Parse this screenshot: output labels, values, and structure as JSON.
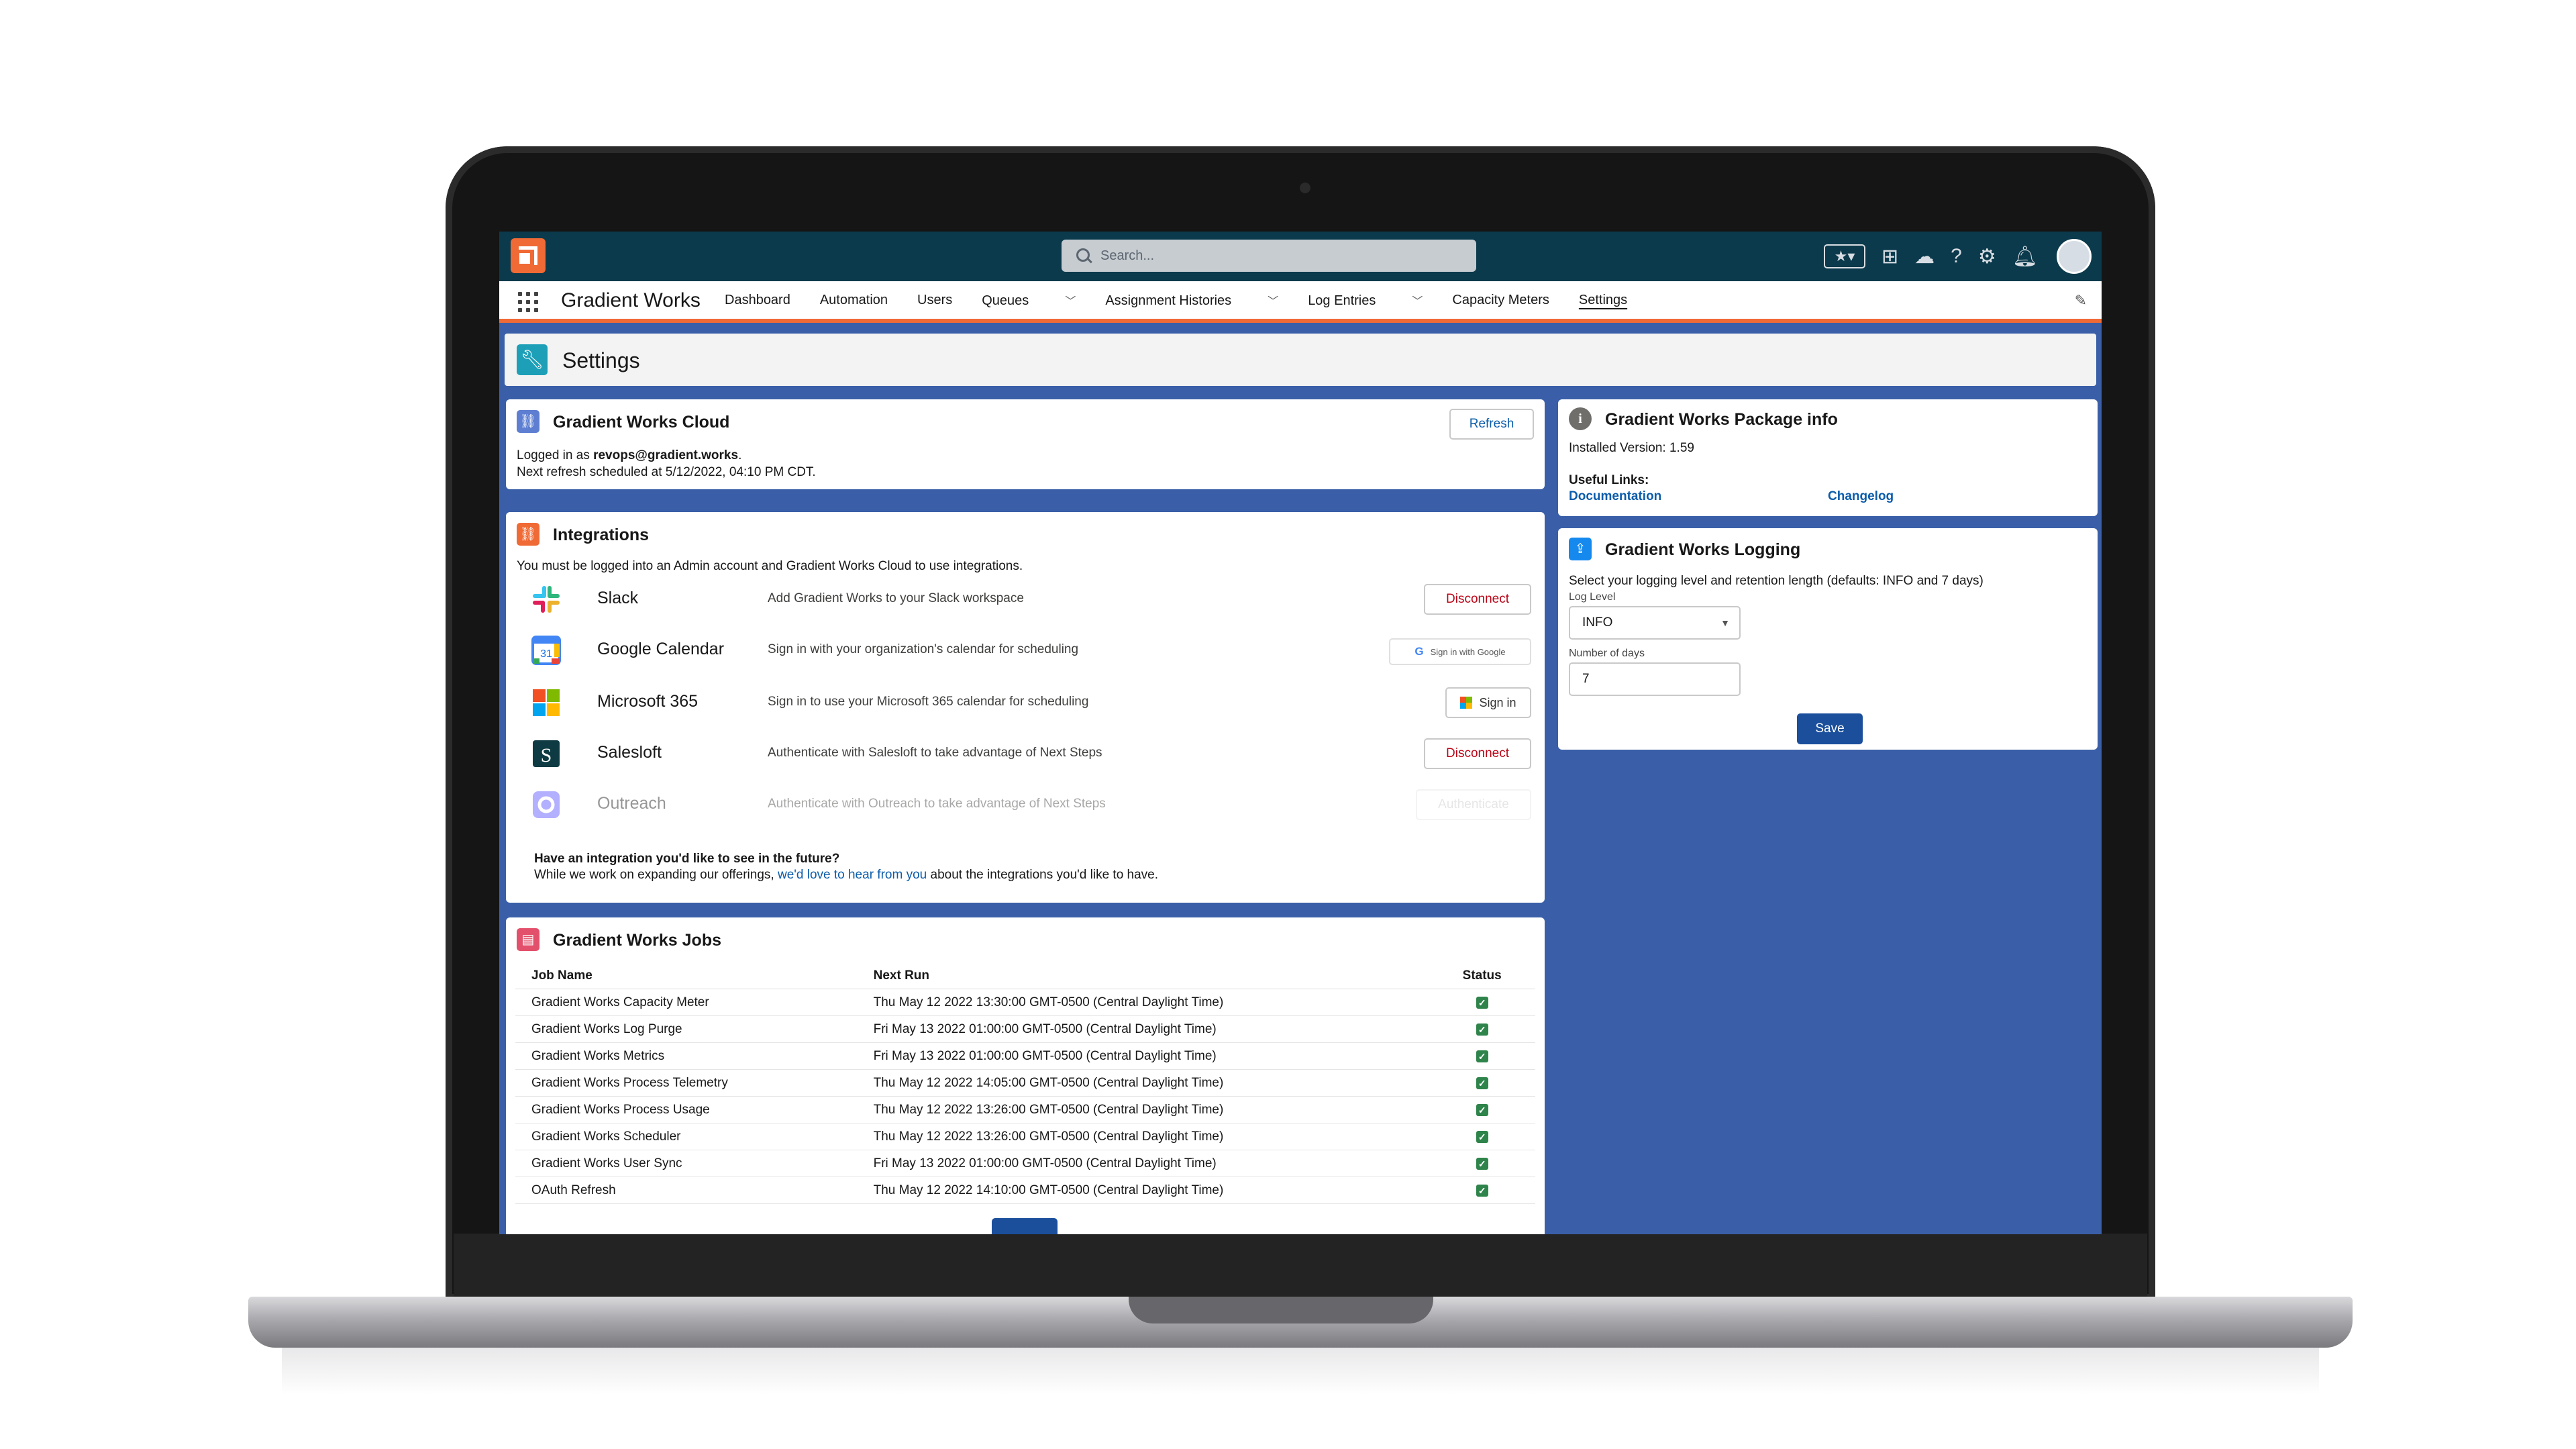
{
  "colors": {
    "brand": "#f06a35",
    "header": "#0b3a4c",
    "blue_bg": "#3a5fa8",
    "link": "#0b5cab",
    "danger": "#ba0517",
    "success": "#2e844a"
  },
  "topbar": {
    "search_placeholder": "Search..."
  },
  "nav": {
    "app_name": "Gradient Works",
    "items": [
      "Dashboard",
      "Automation",
      "Users",
      "Queues",
      "Assignment Histories",
      "Log Entries",
      "Capacity Meters",
      "Settings"
    ],
    "active": "Settings"
  },
  "page": {
    "title": "Settings"
  },
  "cloud": {
    "title": "Gradient Works Cloud",
    "refresh_label": "Refresh",
    "logged_in_prefix": "Logged in as ",
    "logged_in_user": "revops@gradient.works",
    "logged_in_suffix": ".",
    "next_refresh": "Next refresh scheduled at 5/12/2022, 04:10 PM CDT."
  },
  "integrations": {
    "title": "Integrations",
    "intro": "You must be logged into an Admin account and Gradient Works Cloud to use integrations.",
    "items": [
      {
        "name": "Slack",
        "description": "Add Gradient Works to your Slack workspace",
        "action": "Disconnect",
        "icon": "slack-icon"
      },
      {
        "name": "Google Calendar",
        "description": "Sign in with your organization's calendar for scheduling",
        "action": "Sign in with Google",
        "icon": "google-calendar-icon"
      },
      {
        "name": "Microsoft 365",
        "description": "Sign in to use your Microsoft 365 calendar for scheduling",
        "action": "Sign in",
        "icon": "microsoft-icon"
      },
      {
        "name": "Salesloft",
        "description": "Authenticate with Salesloft to take advantage of Next Steps",
        "action": "Disconnect",
        "icon": "salesloft-icon"
      },
      {
        "name": "Outreach",
        "description": "Authenticate with Outreach to take advantage of Next Steps",
        "action": "Authenticate",
        "icon": "outreach-icon"
      }
    ],
    "future_heading": "Have an integration you'd like to see in the future?",
    "future_prefix": "While we work on expanding our offerings, ",
    "future_link": "we'd love to hear from you",
    "future_suffix": " about the integrations you'd like to have."
  },
  "jobs": {
    "title": "Gradient Works Jobs",
    "columns": [
      "Job Name",
      "Next Run",
      "Status"
    ],
    "rows": [
      {
        "name": "Gradient Works Capacity Meter",
        "next_run": "Thu May 12 2022 13:30:00 GMT-0500 (Central Daylight Time)"
      },
      {
        "name": "Gradient Works Log Purge",
        "next_run": "Fri May 13 2022 01:00:00 GMT-0500 (Central Daylight Time)"
      },
      {
        "name": "Gradient Works Metrics",
        "next_run": "Fri May 13 2022 01:00:00 GMT-0500 (Central Daylight Time)"
      },
      {
        "name": "Gradient Works Process Telemetry",
        "next_run": "Thu May 12 2022 14:05:00 GMT-0500 (Central Daylight Time)"
      },
      {
        "name": "Gradient Works Process Usage",
        "next_run": "Thu May 12 2022 13:26:00 GMT-0500 (Central Daylight Time)"
      },
      {
        "name": "Gradient Works Scheduler",
        "next_run": "Thu May 12 2022 13:26:00 GMT-0500 (Central Daylight Time)"
      },
      {
        "name": "Gradient Works User Sync",
        "next_run": "Fri May 13 2022 01:00:00 GMT-0500 (Central Daylight Time)"
      },
      {
        "name": "OAuth Refresh",
        "next_run": "Thu May 12 2022 14:10:00 GMT-0500 (Central Daylight Time)"
      }
    ]
  },
  "package": {
    "title": "Gradient Works Package info",
    "installed_version": "Installed Version: 1.59",
    "useful_links_label": "Useful Links:",
    "documentation": "Documentation",
    "changelog": "Changelog"
  },
  "logging": {
    "title": "Gradient Works Logging",
    "description": "Select your logging level and retention length (defaults: INFO and 7 days)",
    "log_level_label": "Log Level",
    "log_level_value": "INFO",
    "days_label": "Number of days",
    "days_value": "7",
    "save_label": "Save"
  }
}
